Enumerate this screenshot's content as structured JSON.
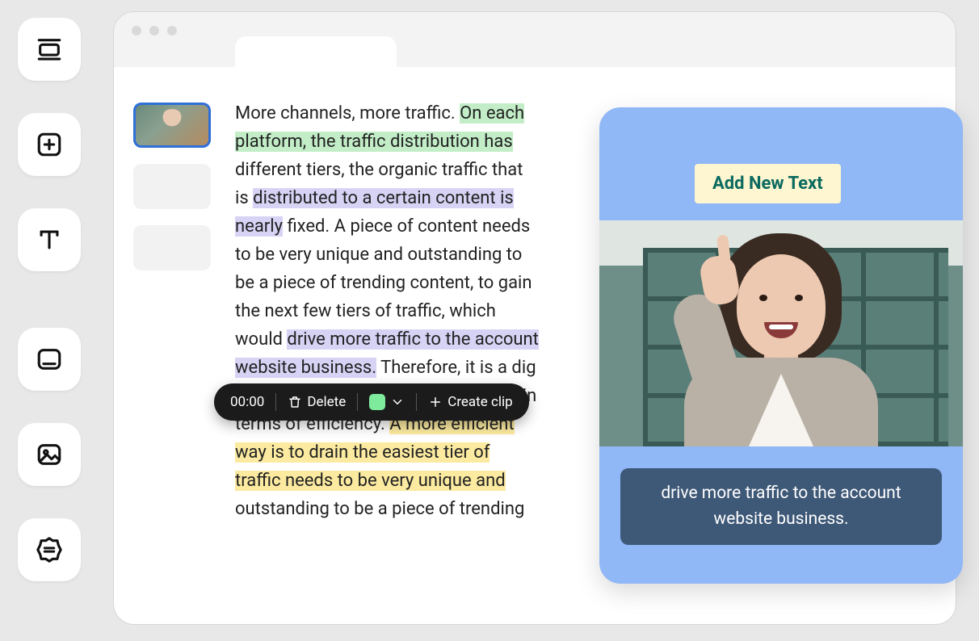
{
  "rail": {
    "items": [
      {
        "name": "slides-tool"
      },
      {
        "name": "add-tool"
      },
      {
        "name": "text-tool"
      },
      {
        "name": "caption-tool"
      },
      {
        "name": "image-tool"
      },
      {
        "name": "settings-tool"
      }
    ]
  },
  "transcript": {
    "segments": [
      {
        "text": "More channels, more traffic. ",
        "hl": null
      },
      {
        "text": "On each platform, the traffic distribution has",
        "hl": "green"
      },
      {
        "text": " different tiers, the organic traffic that is ",
        "hl": null
      },
      {
        "text": "distributed to a certain content is nearly",
        "hl": "purple"
      },
      {
        "text": " fixed. A piece of content needs to be very unique and outstanding to be a piece of trending content, to gain the next few tiers of traffic, which would ",
        "hl": null
      },
      {
        "text": "drive more traffic to the account website business.",
        "hl": "purple"
      },
      {
        "text": " Therefore, it is a dig more traffic from the same platform in terms of efficiency. ",
        "hl": null
      },
      {
        "text": "A more efficient way is to drain the easiest tier of traffic needs to be very unique and",
        "hl": "yellow"
      },
      {
        "text": " outstanding to be a piece of trending",
        "hl": null
      }
    ]
  },
  "actionbar": {
    "time": "00:00",
    "delete_label": "Delete",
    "swatch_color": "#7eea9b",
    "create_label": "Create clip"
  },
  "preview": {
    "add_text_label": "Add New Text",
    "caption": "drive more traffic to the account website business."
  }
}
